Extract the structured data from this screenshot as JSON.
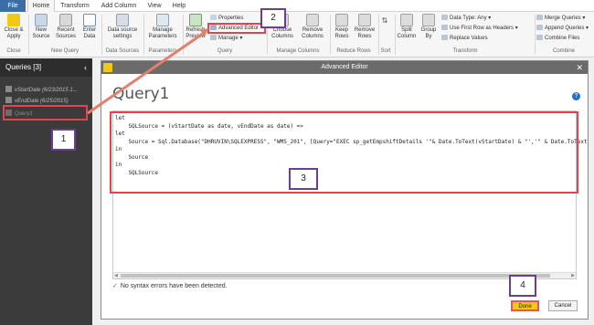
{
  "ribbon": {
    "tabs": [
      "File",
      "Home",
      "Transform",
      "Add Column",
      "View",
      "Help"
    ],
    "buttons": {
      "close_apply": "Close & Apply",
      "new_source": "New Source",
      "recent_sources": "Recent Sources",
      "enter_data": "Enter Data",
      "data_source_settings": "Data source settings",
      "manage_parameters": "Manage Parameters",
      "refresh_preview": "Refresh Preview",
      "properties": "Properties",
      "advanced_editor": "Advanced Editor",
      "manage": "Manage",
      "choose_columns": "Choose Columns",
      "remove_columns": "Remove Columns",
      "keep_rows": "Keep Rows",
      "remove_rows": "Remove Rows",
      "split_column": "Split Column",
      "group_by": "Group By",
      "data_type": "Data Type: Any",
      "use_first_row": "Use First Row as Headers",
      "replace_values": "Replace Values",
      "merge_queries": "Merge Queries",
      "append_queries": "Append Queries",
      "combine_files": "Combine Files"
    },
    "groups": {
      "close": "Close",
      "new_query": "New Query",
      "data_sources": "Data Sources",
      "parameters": "Parameters",
      "query": "Query",
      "manage_columns": "Manage Columns",
      "reduce_rows": "Reduce Rows",
      "sort": "Sort",
      "transform": "Transform",
      "combine": "Combine"
    }
  },
  "queries_pane": {
    "header": "Queries [3]",
    "items": [
      "vStartDate (6/23/2015 1...",
      "vEndDate (6/25/2015)",
      "Query1"
    ]
  },
  "editor": {
    "title": "Advanced Editor",
    "query_name": "Query1",
    "code_lines": [
      "let",
      "    SQLSource = (vStartDate as date, vEndDate as date) =>",
      "let",
      "    Source = Sql.Database(\"DHRUVIN\\SQLEXPRESS\", \"WMS_201\", [Query=\"EXEC sp_getEmpshiftDetails '\"& Date.ToText(vStartDate) & \"','\" & Date.ToText",
      "in",
      "    Source",
      "in",
      "    SQLSource"
    ],
    "status": "No syntax errors have been detected.",
    "done_label": "Done",
    "cancel_label": "Cancel"
  },
  "annotations": [
    "1",
    "2",
    "3",
    "4"
  ],
  "colors": {
    "annotation_red": "#e0454d",
    "callout_border": "#6a3f90",
    "done_yellow": "#f2c811",
    "pane_dark": "#3b3b3b"
  }
}
